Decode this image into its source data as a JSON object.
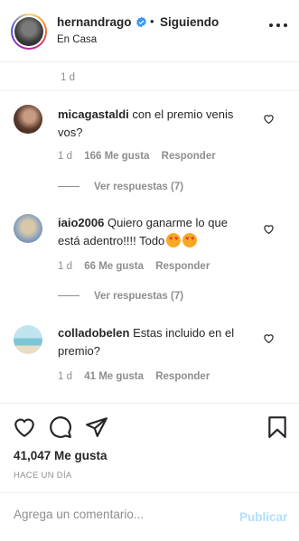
{
  "header": {
    "username": "hernandrago",
    "separator": "•",
    "follow_status": "Siguiendo",
    "location": "En Casa"
  },
  "top_comment": {
    "age": "1 d"
  },
  "comments": [
    {
      "username": "micagastaldi",
      "text_lines": [
        "con el premio venis",
        "vos?"
      ],
      "age": "1 d",
      "likes": "166 Me gusta",
      "reply": "Responder",
      "replies": "Ver respuestas (7)"
    },
    {
      "username": "iaio2006",
      "text_lines": [
        "Quiero ganarme lo que",
        "está adentro!!!! Todo"
      ],
      "age": "1 d",
      "likes": "66 Me gusta",
      "reply": "Responder",
      "replies": "Ver respuestas (7)"
    },
    {
      "username": "colladobelen",
      "text_lines": [
        "Estas incluido en el",
        "premio?"
      ],
      "age": "1 d",
      "likes": "41 Me gusta",
      "reply": "Responder"
    }
  ],
  "actions": {
    "likes_total": "41,047 Me gusta",
    "post_age": "HACE UN DÍA"
  },
  "add_comment": {
    "placeholder": "Agrega un comentario...",
    "publish_label": "Publicar"
  },
  "colors": {
    "text": "#262626",
    "muted": "#8e8e8e",
    "verified": "#3897f0",
    "publish_disabled": "#b2dffc"
  },
  "icons": [
    "more-icon",
    "verified-badge-icon",
    "heart-icon",
    "comment-icon",
    "share-icon",
    "bookmark-icon",
    "star-eyes-emoji-icon"
  ]
}
